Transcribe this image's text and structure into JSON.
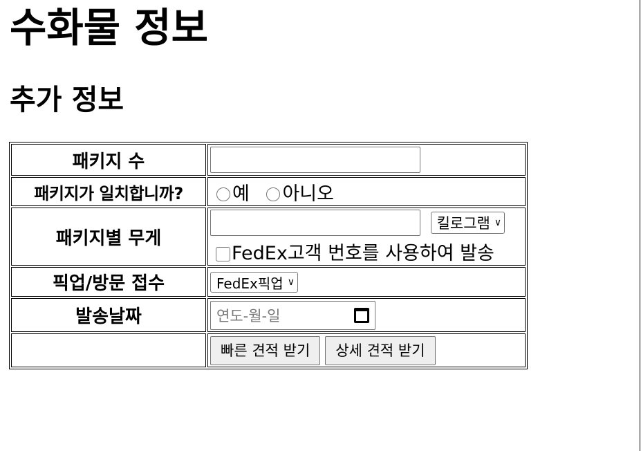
{
  "page": {
    "title": "수화물 정보",
    "subtitle": "추가 정보"
  },
  "form": {
    "packages": {
      "label": "패키지 수",
      "value": ""
    },
    "identical": {
      "label": "패키지가 일치합니까?",
      "options": [
        "예",
        "아니오"
      ]
    },
    "weight": {
      "label": "패키지별 무게",
      "value": "",
      "unit": "킬로그램",
      "account_label": "FedEx고객 번호를 사용하여 발송"
    },
    "pickup": {
      "label": "픽업/방문 접수",
      "selected": "FedEx픽업"
    },
    "ship_date": {
      "label": "발송날짜",
      "placeholder": "연도-월-일"
    },
    "buttons": {
      "quick": "빠른 견적 받기",
      "detailed": "상세 견적 받기"
    }
  }
}
